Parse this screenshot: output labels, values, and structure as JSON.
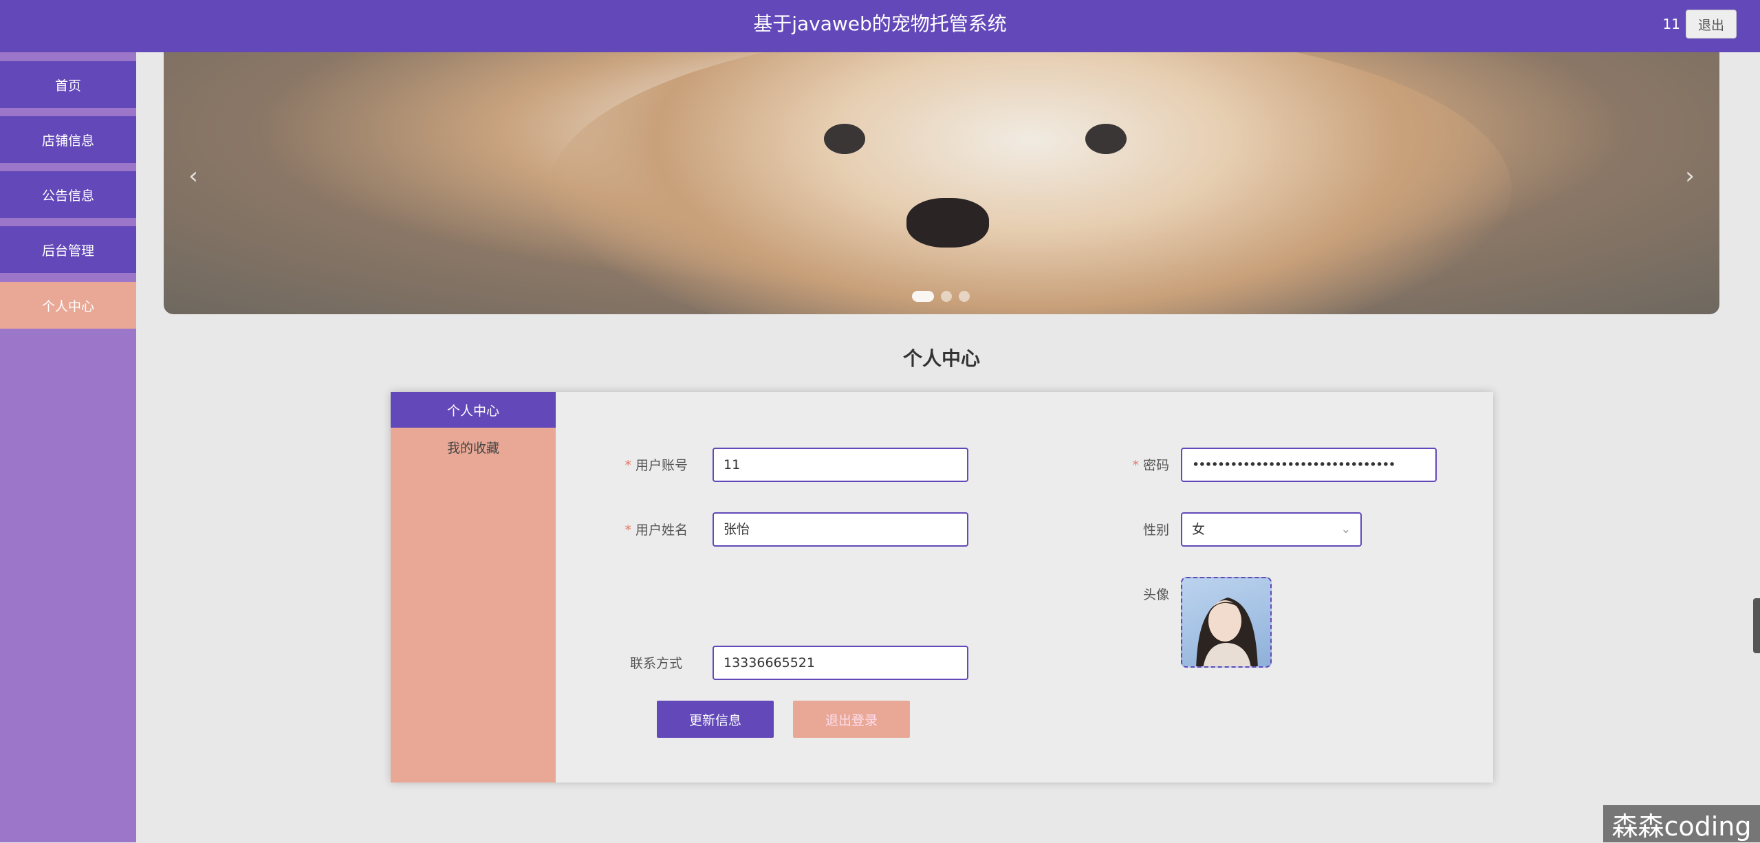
{
  "header": {
    "title": "基于javaweb的宠物托管系统",
    "username": "11",
    "logout_label": "退出"
  },
  "sidebar": {
    "items": [
      {
        "label": "首页"
      },
      {
        "label": "店铺信息"
      },
      {
        "label": "公告信息"
      },
      {
        "label": "后台管理"
      },
      {
        "label": "个人中心",
        "active": true
      }
    ]
  },
  "banner": {
    "prev_icon": "‹",
    "next_icon": "›",
    "slide_count": 3,
    "active_slide": 0
  },
  "section_title": "个人中心",
  "profile": {
    "tabs": [
      {
        "label": "个人中心",
        "active": true
      },
      {
        "label": "我的收藏"
      }
    ],
    "fields": {
      "account": {
        "label": "用户账号",
        "value": "11",
        "required": "*"
      },
      "password": {
        "label": "密码",
        "value": "••••••••••••••••••••••••••••••••",
        "required": "*"
      },
      "name": {
        "label": "用户姓名",
        "value": "张怡",
        "required": "*"
      },
      "gender": {
        "label": "性别",
        "value": "女"
      },
      "avatar": {
        "label": "头像"
      },
      "contact": {
        "label": "联系方式",
        "value": "13336665521"
      }
    },
    "buttons": {
      "update": "更新信息",
      "logout": "退出登录"
    }
  },
  "watermark": "森森coding",
  "colors": {
    "primary": "#6248b8",
    "accent": "#e9a896",
    "sidebar_bg": "#9c76c9"
  }
}
